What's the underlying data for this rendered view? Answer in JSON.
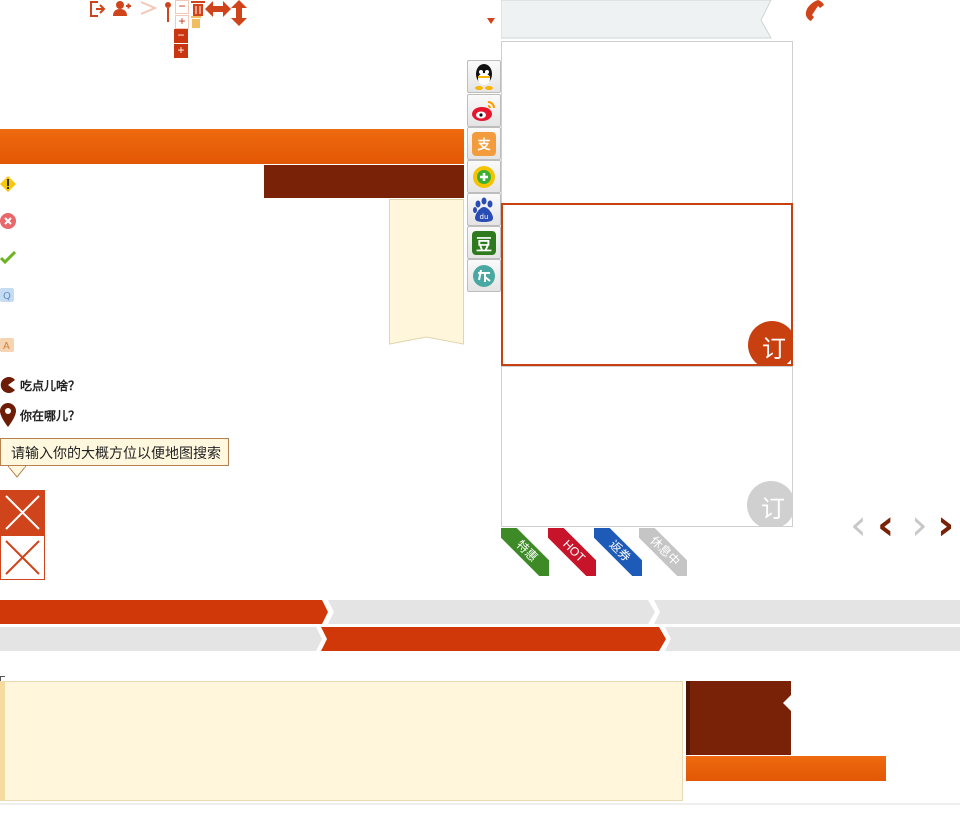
{
  "toolbar": {
    "icons": [
      "logout-icon",
      "add-user-icon",
      "pin-icon",
      "trash-icon",
      "resize-horizontal-icon",
      "resize-vertical-icon"
    ],
    "minus_label": "−",
    "plus_label": "+"
  },
  "phone_icon": "phone-icon",
  "questions": {
    "eat": "吃点儿啥？",
    "where": "你在哪儿？"
  },
  "tip": {
    "text": "请输入你的大概方位以便地图搜索"
  },
  "cards": {
    "order_label": "订"
  },
  "ribbons": [
    "特惠",
    "HOT",
    "返券",
    "休息中"
  ],
  "share_icons": [
    "qq-icon",
    "weibo-icon",
    "alipay-icon",
    "360-icon",
    "baidu-icon",
    "douban-icon",
    "kaixin-icon"
  ],
  "colors": {
    "accent": "#d0441b",
    "orange_bar": "#ea5f06",
    "dark_brown": "#7a2207",
    "cream": "#fff6dc",
    "step_gray": "#e4e4e4"
  }
}
